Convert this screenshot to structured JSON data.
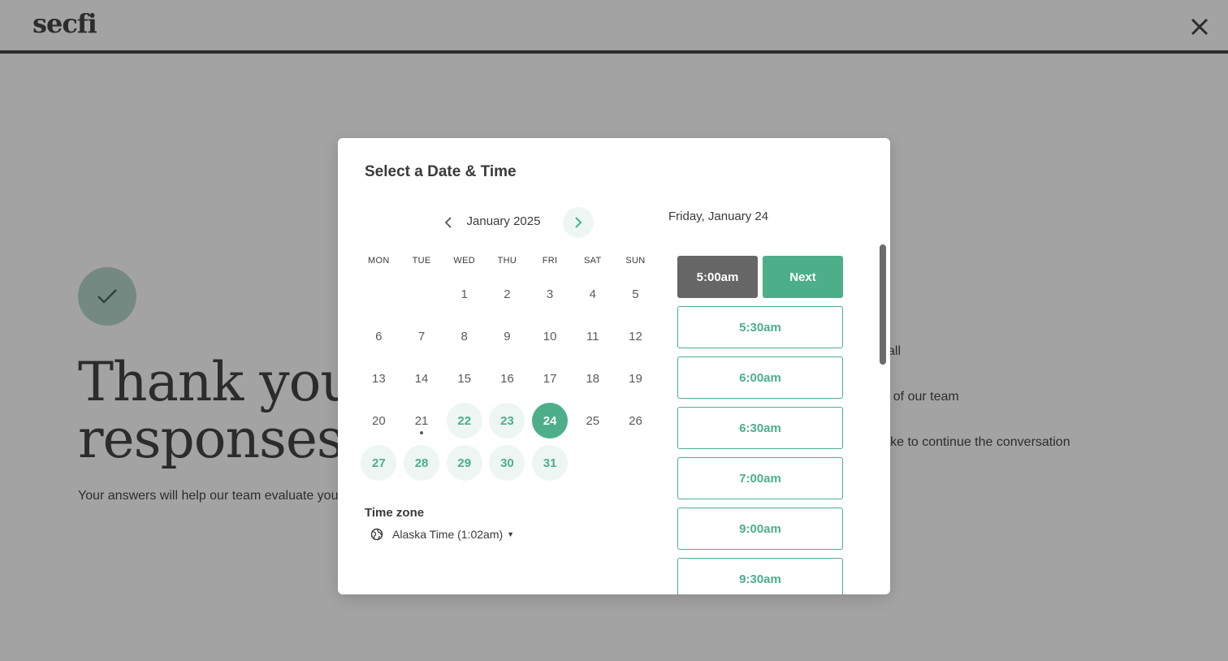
{
  "app": {
    "logo": "secfi"
  },
  "background": {
    "title_line1": "Thank you fo",
    "title_line2": "responses",
    "subtitle": "Your answers will help our team evaluate you",
    "right_text": [
      "all",
      "r of our team",
      "like to continue the conversation"
    ]
  },
  "modal": {
    "title": "Select a Date & Time",
    "month_label": "January 2025",
    "weekdays": [
      "MON",
      "TUE",
      "WED",
      "THU",
      "FRI",
      "SAT",
      "SUN"
    ],
    "days": [
      {
        "n": "",
        "s": "empty"
      },
      {
        "n": "",
        "s": "empty"
      },
      {
        "n": "1",
        "s": "plain"
      },
      {
        "n": "2",
        "s": "plain"
      },
      {
        "n": "3",
        "s": "plain"
      },
      {
        "n": "4",
        "s": "plain"
      },
      {
        "n": "5",
        "s": "plain"
      },
      {
        "n": "6",
        "s": "plain"
      },
      {
        "n": "7",
        "s": "plain"
      },
      {
        "n": "8",
        "s": "plain"
      },
      {
        "n": "9",
        "s": "plain"
      },
      {
        "n": "10",
        "s": "plain"
      },
      {
        "n": "11",
        "s": "plain"
      },
      {
        "n": "12",
        "s": "plain"
      },
      {
        "n": "13",
        "s": "plain"
      },
      {
        "n": "14",
        "s": "plain"
      },
      {
        "n": "15",
        "s": "plain"
      },
      {
        "n": "16",
        "s": "plain"
      },
      {
        "n": "17",
        "s": "plain"
      },
      {
        "n": "18",
        "s": "plain"
      },
      {
        "n": "19",
        "s": "plain"
      },
      {
        "n": "20",
        "s": "plain"
      },
      {
        "n": "21",
        "s": "today"
      },
      {
        "n": "22",
        "s": "avail"
      },
      {
        "n": "23",
        "s": "avail"
      },
      {
        "n": "24",
        "s": "selected"
      },
      {
        "n": "25",
        "s": "plain"
      },
      {
        "n": "26",
        "s": "plain"
      },
      {
        "n": "27",
        "s": "avail"
      },
      {
        "n": "28",
        "s": "avail"
      },
      {
        "n": "29",
        "s": "avail"
      },
      {
        "n": "30",
        "s": "avail"
      },
      {
        "n": "31",
        "s": "avail"
      }
    ],
    "timezone_label": "Time zone",
    "timezone_value": "Alaska Time (1:02am)",
    "selected_date": "Friday, January 24",
    "selected_time": "5:00am",
    "next_label": "Next",
    "time_slots": [
      "5:30am",
      "6:00am",
      "6:30am",
      "7:00am",
      "9:00am",
      "9:30am"
    ]
  },
  "colors": {
    "accent": "#4caf8a",
    "accent_light": "#eef6f3",
    "selected_slot": "#666666"
  }
}
